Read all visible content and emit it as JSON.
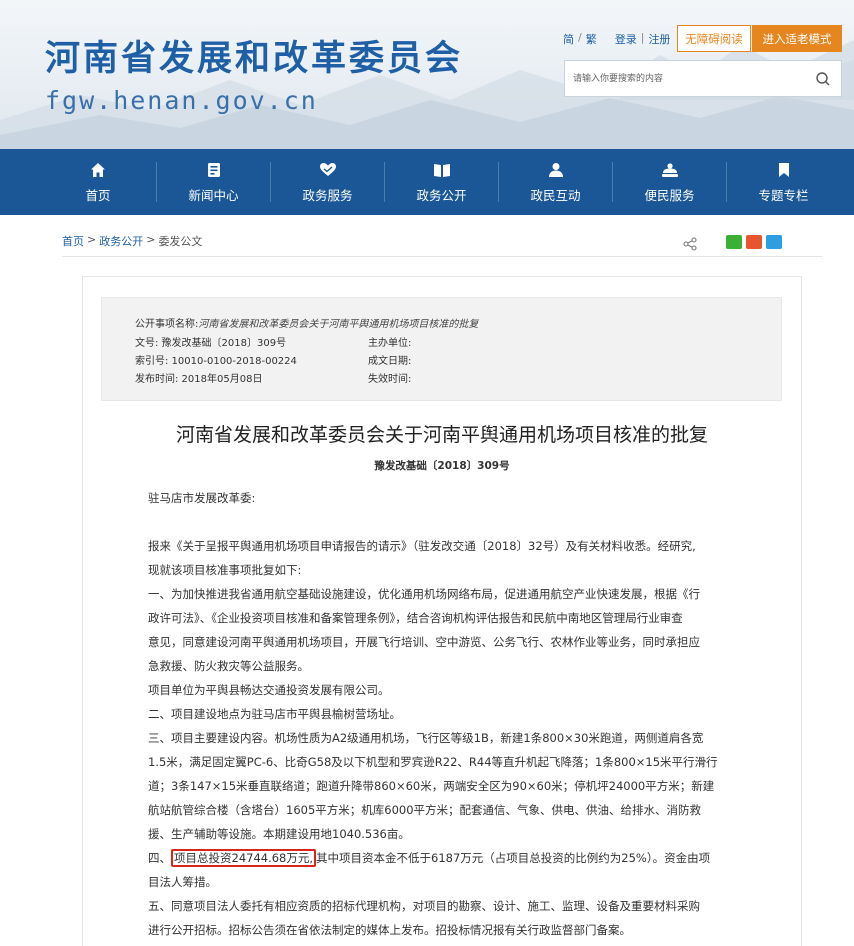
{
  "header": {
    "title": "河南省发展和改革委员会",
    "domain": "fgw.henan.gov.cn",
    "links": {
      "simplified": "简",
      "traditional": "繁",
      "login": "登录",
      "register": "注册"
    },
    "accessible_label": "无障碍阅读",
    "elder_label": "进入适老模式",
    "search_placeholder": "请输入你要搜索的内容"
  },
  "nav": {
    "items": [
      {
        "label": "首页",
        "icon": "home-icon"
      },
      {
        "label": "新闻中心",
        "icon": "news-icon"
      },
      {
        "label": "政务服务",
        "icon": "heart-hand-icon"
      },
      {
        "label": "政务公开",
        "icon": "book-icon"
      },
      {
        "label": "政民互动",
        "icon": "user-icon"
      },
      {
        "label": "便民服务",
        "icon": "service-icon"
      },
      {
        "label": "专题专栏",
        "icon": "bookmark-icon"
      }
    ]
  },
  "breadcrumb": {
    "home": "首页",
    "sep": ">",
    "section": "政务公开",
    "current": "委发公文"
  },
  "meta": {
    "item_name_label": "公开事项名称:",
    "item_name": "河南省发展和改革委员会关于河南平舆通用机场项目核准的批复",
    "doc_no": "文号:  豫发改基础〔2018〕309号",
    "issuer": "主办单位:",
    "index_no": "索引号:  10010-0100-2018-00224",
    "created": "成文日期:",
    "published": "发布时间:  2018年05月08日",
    "expired": "失效时间:"
  },
  "doc": {
    "title": "河南省发展和改革委员会关于河南平舆通用机场项目核准的批复",
    "number": "豫发改基础〔2018〕309号",
    "addressee": "驻马店市发展改革委:",
    "lines": [
      "报来《关于呈报平舆通用机场项目申请报告的请示》（驻发改交通〔2018〕32号）及有关材料收悉。经研究,",
      "现就该项目核准事项批复如下:",
      "一、为加快推进我省通用航空基础设施建设，优化通用机场网络布局，促进通用航空产业快速发展，根据《行",
      "政许可法》、《企业投资项目核准和备案管理条例》，结合咨询机构评估报告和民航中南地区管理局行业审查",
      "意见，同意建设河南平舆通用机场项目，开展飞行培训、空中游览、公务飞行、农林作业等业务，同时承担应",
      "急救援、防火救灾等公益服务。",
      "项目单位为平舆县畅达交通投资发展有限公司。",
      "二、项目建设地点为驻马店市平舆县榆树营场址。",
      "三、项目主要建设内容。机场性质为A2级通用机场，飞行区等级1B，新建1条800×30米跑道，两侧道肩各宽",
      "1.5米，满足固定翼PC-6、比奇G58及以下机型和罗宾逊R22、R44等直升机起飞降落；1条800×15米平行滑行",
      "道；3条147×15米垂直联络道；跑道升降带860×60米，两端安全区为90×60米；停机坪24000平方米；新建",
      "航站航管综合楼（含塔台）1605平方米；机库6000平方米；配套通信、气象、供电、供油、给排水、消防救",
      "援、生产辅助等设施。本期建设用地1040.536亩。"
    ],
    "line_four_prefix": "四、",
    "line_four_highlight": "项目总投资24744.68万元,",
    "line_four_rest": "其中项目资本金不低于6187万元（占项目总投资的比例约为25%）。资金由项",
    "line_four_cont": "目法人筹措。",
    "line_five": "五、同意项目法人委托有相应资质的招标代理机构，对项目的勘察、设计、施工、监理、设备及重要材料采购",
    "line_five_cont": "进行公开招标。招标公告须在省依法制定的媒体上发布。招投标情况报有关行政监督部门备案。"
  },
  "colors": {
    "brand": "#1b5796",
    "accent": "#e6861f",
    "highlight": "#d9261c"
  }
}
